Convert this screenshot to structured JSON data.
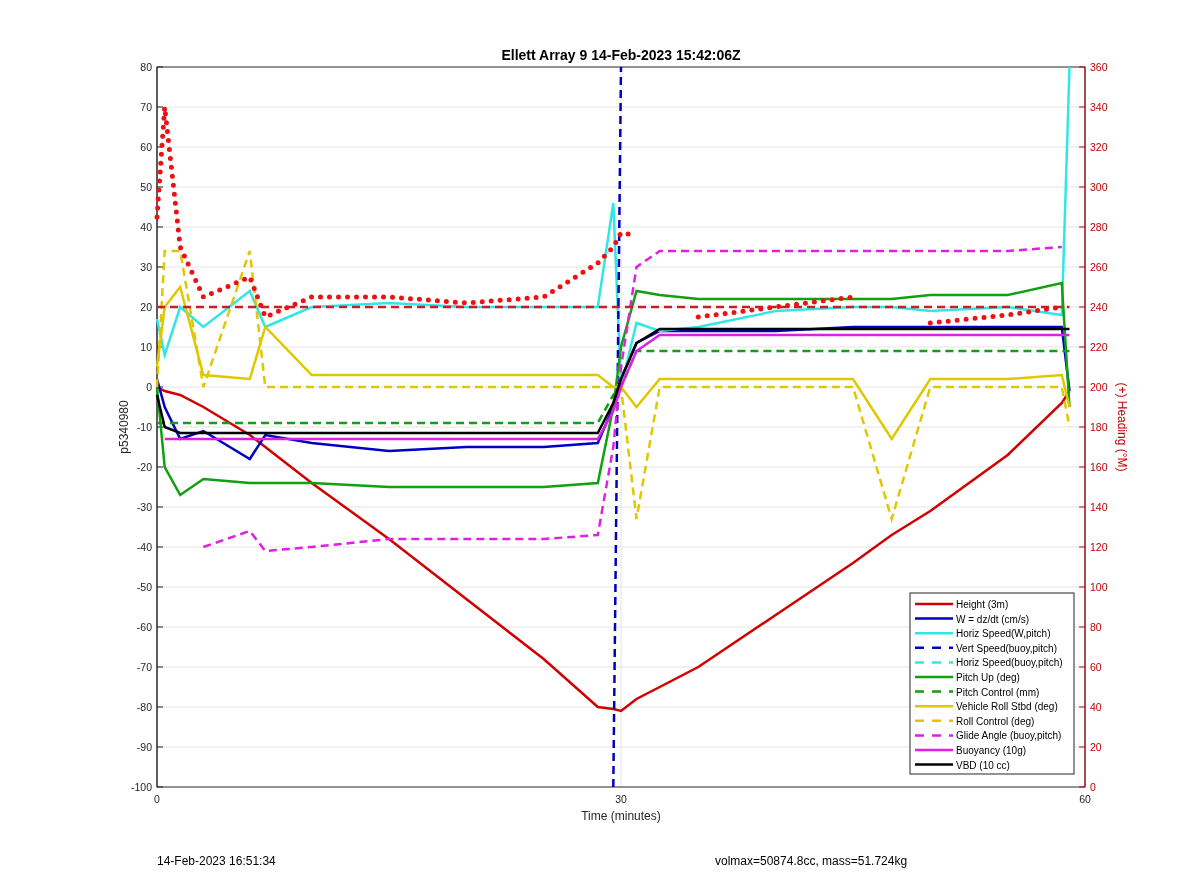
{
  "figure": {
    "chart_data": {
      "type": "line",
      "title": "Ellett Array 9 14-Feb-2023 15:42:06Z",
      "xlabel": "Time (minutes)",
      "ylabel": "p5340980",
      "y2label": "(+) Heading (°M)",
      "xlim": [
        0,
        60
      ],
      "ylim": [
        -100,
        80
      ],
      "y2lim": [
        0,
        360
      ],
      "xticks": [
        0,
        30,
        60
      ],
      "yticks": [
        -100,
        -90,
        -80,
        -70,
        -60,
        -50,
        -40,
        -30,
        -20,
        -10,
        0,
        10,
        20,
        30,
        40,
        50,
        60,
        70,
        80
      ],
      "y2ticks": [
        0,
        20,
        40,
        60,
        80,
        100,
        120,
        140,
        160,
        180,
        200,
        220,
        240,
        260,
        280,
        300,
        320,
        340,
        360
      ],
      "grid": true,
      "legend": true,
      "x": [
        0,
        0.5,
        1.5,
        3,
        6,
        7,
        10,
        15,
        20,
        25,
        28.5,
        29.5,
        30,
        31,
        32.5,
        35,
        40,
        45,
        47.5,
        50,
        55,
        58.5,
        59
      ],
      "series": [
        {
          "name": "Height (3m)",
          "color": "#d00000",
          "line_style": "solid",
          "values": [
            0,
            -1,
            -2,
            -5,
            -12,
            -15,
            -24,
            -38,
            -53,
            -68,
            -80,
            -80.5,
            -81,
            -78,
            -75,
            -70,
            -57,
            -44,
            -37,
            -31,
            -17,
            -4,
            -1
          ]
        },
        {
          "name": "W = dz/dt (cm/s)",
          "color": "#0000c0",
          "line_style": "solid",
          "values": [
            2,
            -5,
            -13,
            -11,
            -18,
            -12,
            -14,
            -16,
            -15,
            -15,
            -14,
            -5,
            2,
            11,
            14,
            14,
            14,
            15,
            15,
            15,
            15,
            15,
            -1
          ]
        },
        {
          "name": "Horiz Speed(W,pitch)",
          "color": "#33e6e6",
          "line_style": "solid",
          "values": [
            17,
            8,
            20,
            15,
            24,
            15,
            20,
            21,
            20,
            20,
            20,
            46,
            0,
            16,
            14,
            15,
            19,
            20,
            20,
            19,
            20,
            18,
            80
          ]
        },
        {
          "name": "Vert Speed(buoy,pitch)",
          "color": "#0000c0",
          "line_style": "dashed",
          "values": [
            null,
            null,
            null,
            null,
            null,
            null,
            null,
            null,
            null,
            null,
            null,
            -100,
            80,
            null,
            null,
            null,
            null,
            null,
            null,
            null,
            null,
            null,
            null
          ]
        },
        {
          "name": "Horiz Speed(buoy,pitch)",
          "color": "#33e6e6",
          "line_style": "dashed",
          "values": [
            null,
            null,
            null,
            null,
            null,
            null,
            null,
            null,
            null,
            null,
            null,
            null,
            null,
            null,
            null,
            null,
            null,
            null,
            null,
            null,
            null,
            null,
            null
          ]
        },
        {
          "name": "Pitch Up (deg)",
          "color": "#10a010",
          "line_style": "solid",
          "values": [
            0,
            -20,
            -27,
            -23,
            -24,
            -24,
            -24,
            -25,
            -25,
            -25,
            -24,
            -5,
            10,
            24,
            23,
            22,
            22,
            22,
            22,
            23,
            23,
            26,
            -5
          ]
        },
        {
          "name": "Pitch Control (mm)",
          "color": "#10a010",
          "line_style": "dashed",
          "values": [
            -9,
            -9,
            -9,
            -9,
            -9,
            -9,
            -9,
            -9,
            -9,
            -9,
            -9,
            -2,
            0,
            9,
            9,
            9,
            9,
            9,
            9,
            9,
            9,
            9,
            9
          ]
        },
        {
          "name": "Vehicle Roll Stbd (deg)",
          "color": "#e0c800",
          "line_style": "solid",
          "values": [
            5,
            20,
            25,
            3,
            2,
            15,
            3,
            3,
            3,
            3,
            3,
            0,
            0,
            -5,
            2,
            2,
            2,
            2,
            -13,
            2,
            2,
            3,
            -5
          ]
        },
        {
          "name": "Roll Control (deg)",
          "color": "#e0c800",
          "line_style": "dashed",
          "values": [
            0,
            34,
            34,
            0,
            34,
            0,
            0,
            0,
            0,
            0,
            0,
            0,
            0,
            -33,
            0,
            0,
            0,
            0,
            -33,
            0,
            0,
            0,
            -10
          ]
        },
        {
          "name": "Glide Angle (buoy,pitch)",
          "color": "#e020e0",
          "line_style": "dashed",
          "values": [
            null,
            null,
            null,
            -40,
            -36,
            -41,
            -40,
            -38,
            -38,
            -38,
            -37,
            -15,
            5,
            30,
            34,
            34,
            34,
            34,
            34,
            34,
            34,
            35,
            null
          ]
        },
        {
          "name": "Buoyancy (10g)",
          "color": "#e020e0",
          "line_style": "solid",
          "values": [
            null,
            -13,
            -13,
            -13,
            -13,
            -13,
            -13,
            -13,
            -13,
            -13,
            -13,
            -6,
            0,
            9,
            13,
            13,
            13,
            13,
            13,
            13,
            13,
            13,
            13
          ]
        },
        {
          "name": "VBD (10 cc)",
          "color": "#000000",
          "line_style": "solid",
          "values": [
            -2,
            -10,
            -11.5,
            -11.5,
            -11.5,
            -11.5,
            -11.5,
            -11.5,
            -11.5,
            -11.5,
            -11.5,
            -4,
            2,
            11,
            14.5,
            14.5,
            14.5,
            14.5,
            14.5,
            14.5,
            14.5,
            14.5,
            14.5
          ]
        },
        {
          "color": "#c81e28",
          "line_style": "dashed",
          "axis": "y2",
          "values": [
            240,
            240,
            240,
            240,
            240,
            240,
            240,
            240,
            240,
            240,
            240,
            240,
            240,
            240,
            240,
            240,
            240,
            240,
            240,
            240,
            240,
            240,
            240
          ]
        },
        {
          "color": "#ee1111",
          "line_style": "dotted",
          "axis": "y2",
          "values": [
            285,
            340,
            270,
            245,
            255,
            235,
            245,
            245,
            242,
            245,
            262,
            270,
            277,
            276,
            null,
            235,
            240,
            245,
            null,
            232,
            236,
            240,
            null
          ]
        }
      ]
    }
  },
  "footer": {
    "timestamp": "14-Feb-2023 16:51:34",
    "summary": "volmax=50874.8cc, mass=51.724kg"
  }
}
